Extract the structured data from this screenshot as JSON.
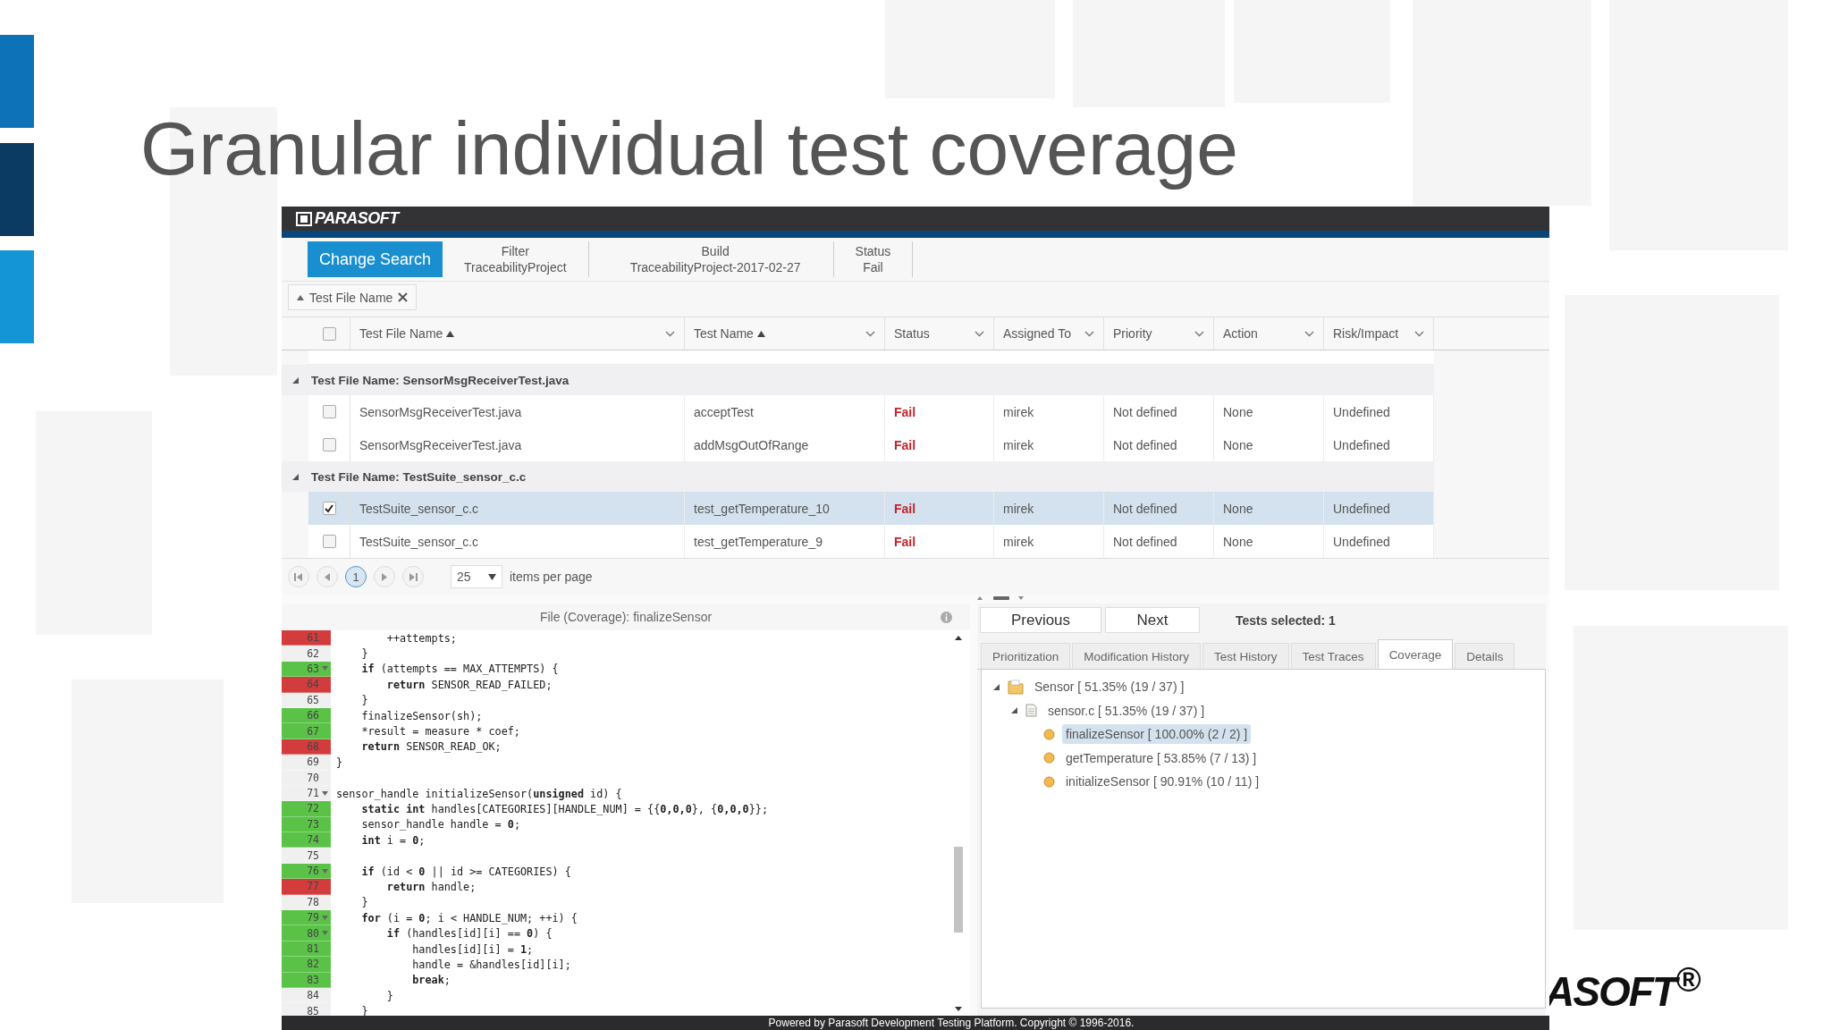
{
  "slide": {
    "title": "Granular individual test coverage",
    "logo_text": "ASOFT$^{®}$"
  },
  "app": {
    "brand": "PARASOFT",
    "toolbar": {
      "button": "Change Search",
      "facets": [
        {
          "label": "Filter",
          "value": "TraceabilityProject"
        },
        {
          "label": "Build",
          "value": "TraceabilityProject-2017-02-27"
        },
        {
          "label": "Status",
          "value": "Fail"
        }
      ]
    },
    "group_chip": {
      "label": "Test File Name"
    },
    "table": {
      "header_checked": false,
      "columns": [
        {
          "label": "Test File Name",
          "sorted": true,
          "kind": "text"
        },
        {
          "label": "Test Name",
          "sorted": true,
          "kind": "text"
        },
        {
          "label": "Status",
          "sorted": false,
          "kind": "status"
        },
        {
          "label": "Assigned To",
          "sorted": false,
          "kind": "text"
        },
        {
          "label": "Priority",
          "sorted": false,
          "kind": "text"
        },
        {
          "label": "Action",
          "sorted": false,
          "kind": "text"
        },
        {
          "label": "Risk/Impact",
          "sorted": false,
          "kind": "text"
        }
      ],
      "groups": [
        {
          "title": "Test File Name: SensorMsgReceiverTest.java",
          "expanded": true,
          "rows": [
            {
              "checked": false,
              "selected": false,
              "cells": [
                "SensorMsgReceiverTest.java",
                "acceptTest",
                "Fail",
                "mirek",
                "Not defined",
                "None",
                "Undefined"
              ]
            },
            {
              "checked": false,
              "selected": false,
              "cells": [
                "SensorMsgReceiverTest.java",
                "addMsgOutOfRange",
                "Fail",
                "mirek",
                "Not defined",
                "None",
                "Undefined"
              ]
            }
          ]
        },
        {
          "title": "Test File Name: TestSuite_sensor_c.c",
          "expanded": true,
          "rows": [
            {
              "checked": true,
              "selected": true,
              "cells": [
                "TestSuite_sensor_c.c",
                "test_getTemperature_10",
                "Fail",
                "mirek",
                "Not defined",
                "None",
                "Undefined"
              ]
            },
            {
              "checked": false,
              "selected": false,
              "cells": [
                "TestSuite_sensor_c.c",
                "test_getTemperature_9",
                "Fail",
                "mirek",
                "Not defined",
                "None",
                "Undefined"
              ]
            }
          ]
        }
      ]
    },
    "pager": {
      "pages": [
        {
          "label": "1",
          "selected": true
        }
      ],
      "page_size": "25",
      "page_size_label": "items per page"
    },
    "code_panel": {
      "title": "File (Coverage): finalizeSensor",
      "lines": [
        {
          "n": "61",
          "covered": false,
          "fold": false,
          "kind": "markup",
          "text": "        ++attempts;"
        },
        {
          "n": "62",
          "fold": false,
          "kind": "markup",
          "text": "    }"
        },
        {
          "n": "63",
          "covered": true,
          "fold": true,
          "kind": "markup",
          "text": "    **if** (attempts == MAX_ATTEMPTS) {"
        },
        {
          "n": "64",
          "covered": false,
          "fold": false,
          "kind": "markup",
          "text": "        **return** SENSOR_READ_FAILED;"
        },
        {
          "n": "65",
          "fold": false,
          "kind": "markup",
          "text": "    }"
        },
        {
          "n": "66",
          "covered": true,
          "fold": false,
          "kind": "markup",
          "text": "    finalizeSensor(sh);"
        },
        {
          "n": "67",
          "covered": true,
          "fold": false,
          "kind": "plain",
          "text": "    *result = measure * coef;"
        },
        {
          "n": "68",
          "covered": false,
          "fold": false,
          "kind": "markup",
          "text": "    **return** SENSOR_READ_OK;"
        },
        {
          "n": "69",
          "fold": false,
          "kind": "markup",
          "text": "}"
        },
        {
          "n": "70",
          "fold": false
        },
        {
          "n": "71",
          "fold": true,
          "kind": "markup",
          "text": "sensor_handle initializeSensor(**unsigned** id) {"
        },
        {
          "n": "72",
          "covered": true,
          "fold": false,
          "kind": "markup",
          "text": "    **static int** handles[CATEGORIES][HANDLE_NUM] = {{**0,0,0**}, {**0,0,0**}};"
        },
        {
          "n": "73",
          "covered": true,
          "fold": false,
          "kind": "markup",
          "text": "    sensor_handle handle = **0**;"
        },
        {
          "n": "74",
          "covered": true,
          "fold": false,
          "kind": "markup",
          "text": "    **int** i = **0**;"
        },
        {
          "n": "75",
          "fold": false
        },
        {
          "n": "76",
          "covered": true,
          "fold": true,
          "kind": "markup",
          "text": "    **if** (id < **0** || id >= CATEGORIES) {"
        },
        {
          "n": "77",
          "covered": false,
          "fold": false,
          "kind": "markup",
          "text": "        **return** handle;"
        },
        {
          "n": "78",
          "fold": false,
          "kind": "markup",
          "text": "    }"
        },
        {
          "n": "79",
          "covered": true,
          "fold": true,
          "kind": "markup",
          "text": "    **for** (i = **0**; i < HANDLE_NUM; ++i) {"
        },
        {
          "n": "80",
          "covered": true,
          "fold": true,
          "kind": "markup",
          "text": "        **if** (handles[id][i] == **0**) {"
        },
        {
          "n": "81",
          "covered": true,
          "fold": false,
          "kind": "markup",
          "text": "            handles[id][i] = **1**;"
        },
        {
          "n": "82",
          "covered": true,
          "fold": false,
          "kind": "markup",
          "text": "            handle = &handles[id][i];"
        },
        {
          "n": "83",
          "covered": true,
          "fold": false,
          "kind": "markup",
          "text": "            **break**;"
        },
        {
          "n": "84",
          "fold": false,
          "kind": "markup",
          "text": "        }"
        },
        {
          "n": "85",
          "fold": false,
          "kind": "markup",
          "text": "    }"
        }
      ]
    },
    "details": {
      "buttons": [
        "Previous",
        "Next"
      ],
      "selection_count": "Tests selected: 1",
      "tabs": [
        {
          "label": "Prioritization",
          "selected": false
        },
        {
          "label": "Modification History",
          "selected": false
        },
        {
          "label": "Test History",
          "selected": false
        },
        {
          "label": "Test Traces",
          "selected": false
        },
        {
          "label": "Coverage",
          "selected": true
        },
        {
          "label": "Details",
          "selected": false
        }
      ],
      "tree": [
        {
          "label": "Sensor [ 51.35% (19 / 37) ]",
          "kind": "folder",
          "expanded": true,
          "selected": false,
          "children": [
            {
              "label": "sensor.c [ 51.35% (19 / 37) ]",
              "kind": "file",
              "expanded": true,
              "selected": false,
              "children": [
                {
                  "label": "finalizeSensor [ 100.00% (2 / 2) ]",
                  "kind": "function",
                  "selected": true
                },
                {
                  "label": "getTemperature [ 53.85% (7 / 13) ]",
                  "kind": "function",
                  "selected": false
                },
                {
                  "label": "initializeSensor [ 90.91% (10 / 11) ]",
                  "kind": "function",
                  "selected": false
                }
              ]
            }
          ]
        }
      ]
    },
    "footer": "Powered by Parasoft Development Testing Platform. Copyright © 1996-2016."
  }
}
